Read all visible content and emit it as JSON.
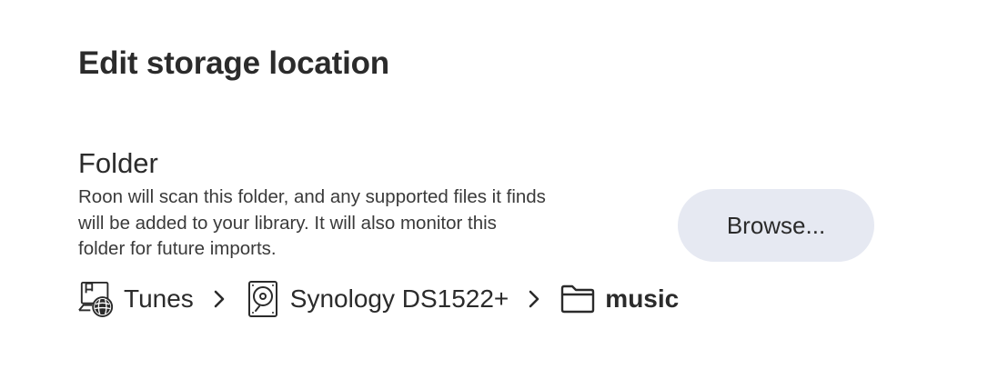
{
  "dialog": {
    "title": "Edit storage location"
  },
  "folder_section": {
    "label": "Folder",
    "description_lines": [
      "Roon will scan this folder, and any supported files it finds",
      "will be added to your library. It will also monitor this",
      "folder for future imports."
    ],
    "browse_label": "Browse..."
  },
  "breadcrumb": {
    "items": [
      {
        "label": "Tunes",
        "icon": "network-share-icon"
      },
      {
        "label": "Synology DS1522+",
        "icon": "hard-drive-icon"
      },
      {
        "label": "music",
        "icon": "folder-icon"
      }
    ],
    "separator_icon": "chevron-right-icon"
  },
  "colors": {
    "text": "#2b2b2b",
    "button_bg": "#e6e9f2",
    "background": "#ffffff"
  }
}
